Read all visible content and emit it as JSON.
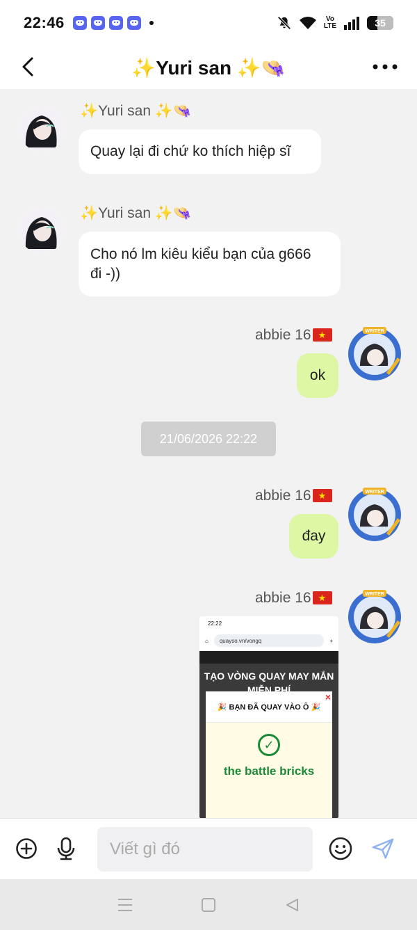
{
  "status_bar": {
    "time": "22:46",
    "volte_top": "Vo",
    "volte_bottom": "LTE",
    "battery": "35",
    "icons": [
      "discord-icon",
      "discord-icon",
      "discord-icon",
      "discord-icon",
      "dot",
      "mute-icon",
      "wifi-icon",
      "volte-icon",
      "signal-icon",
      "battery-icon"
    ]
  },
  "header": {
    "title": "✨Yuri san ✨👒",
    "back_icon": "chevron-left-icon",
    "more_icon": "more-horizontal-icon"
  },
  "messages": [
    {
      "direction": "in",
      "sender": "✨Yuri san ✨👒",
      "text": "Quay lại đi chứ ko thích hiệp sĩ"
    },
    {
      "direction": "in",
      "sender": "✨Yuri san ✨👒",
      "text": "Cho nó lm kiêu kiểu bạn của g666 đi -))"
    },
    {
      "direction": "out",
      "sender": "abbie 16",
      "text": "ok"
    },
    {
      "timestamp": "21/06/2026 22:22"
    },
    {
      "direction": "out",
      "sender": "abbie 16",
      "text": "đay"
    },
    {
      "direction": "out",
      "sender": "abbie 16",
      "attachment": "screenshot"
    }
  ],
  "attachment": {
    "status_time": "22:22",
    "url": "quayso.vn/vongq",
    "heading": "TẠO VÒNG QUAY MAY MẮN MIỄN PHÍ",
    "modal_title": "🎉 BẠN ĐÃ QUAY VÀO Ô 🎉",
    "prize": "the battle bricks",
    "close": "×"
  },
  "composer": {
    "placeholder": "Viết gì đó",
    "value": ""
  },
  "colors": {
    "outgoing_bubble": "#ddf7a5",
    "incoming_bubble": "#ffffff",
    "background": "#f2f2f3",
    "send_icon": "#8fb3ef"
  }
}
